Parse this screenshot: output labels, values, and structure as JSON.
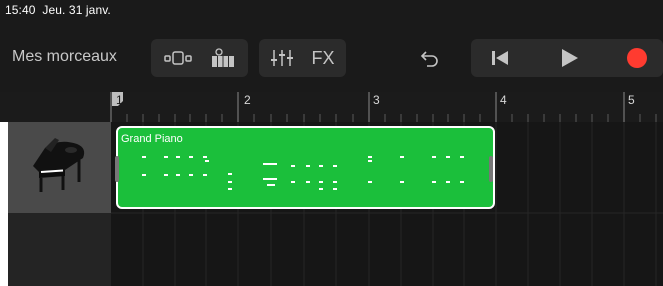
{
  "status": {
    "time": "15:40",
    "date": "Jeu. 31 janv."
  },
  "toolbar": {
    "title": "Mes morceaux",
    "fx_label": "FX",
    "icons": [
      "tracks-view-icon",
      "piano-keys-icon",
      "mixer-icon",
      "fx-icon",
      "undo-icon",
      "rewind-icon",
      "play-icon",
      "record-icon"
    ]
  },
  "ruler": {
    "bars": [
      "1",
      "2",
      "3",
      "4",
      "5"
    ]
  },
  "track": {
    "instrument": "Grand Piano",
    "region_label": "Grand Piano"
  },
  "colors": {
    "region": "#1bbf3b",
    "record": "#ff3b30",
    "background": "#161616"
  }
}
